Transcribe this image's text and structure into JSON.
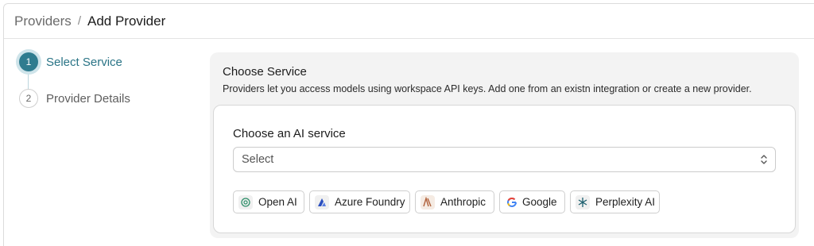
{
  "breadcrumb": {
    "parent": "Providers",
    "separator": "/",
    "current": "Add Provider"
  },
  "steps": [
    {
      "number": "1",
      "label": "Select Service",
      "state": "active"
    },
    {
      "number": "2",
      "label": "Provider Details",
      "state": "pending"
    }
  ],
  "panel": {
    "title": "Choose Service",
    "description": "Providers let you access models using workspace API keys. Add one from an existn integration or create a new provider."
  },
  "service_field": {
    "label": "Choose an AI service",
    "value": "Select"
  },
  "service_options": [
    {
      "label": "Open AI",
      "icon": "openai-icon"
    },
    {
      "label": "Azure Foundry",
      "icon": "azure-icon"
    },
    {
      "label": "Anthropic",
      "icon": "anthropic-icon"
    },
    {
      "label": "Google",
      "icon": "google-icon"
    },
    {
      "label": "Perplexity AI",
      "icon": "perplexity-icon"
    }
  ],
  "colors": {
    "accent": "#2f7c8f",
    "panel_bg": "#f3f3f3"
  }
}
